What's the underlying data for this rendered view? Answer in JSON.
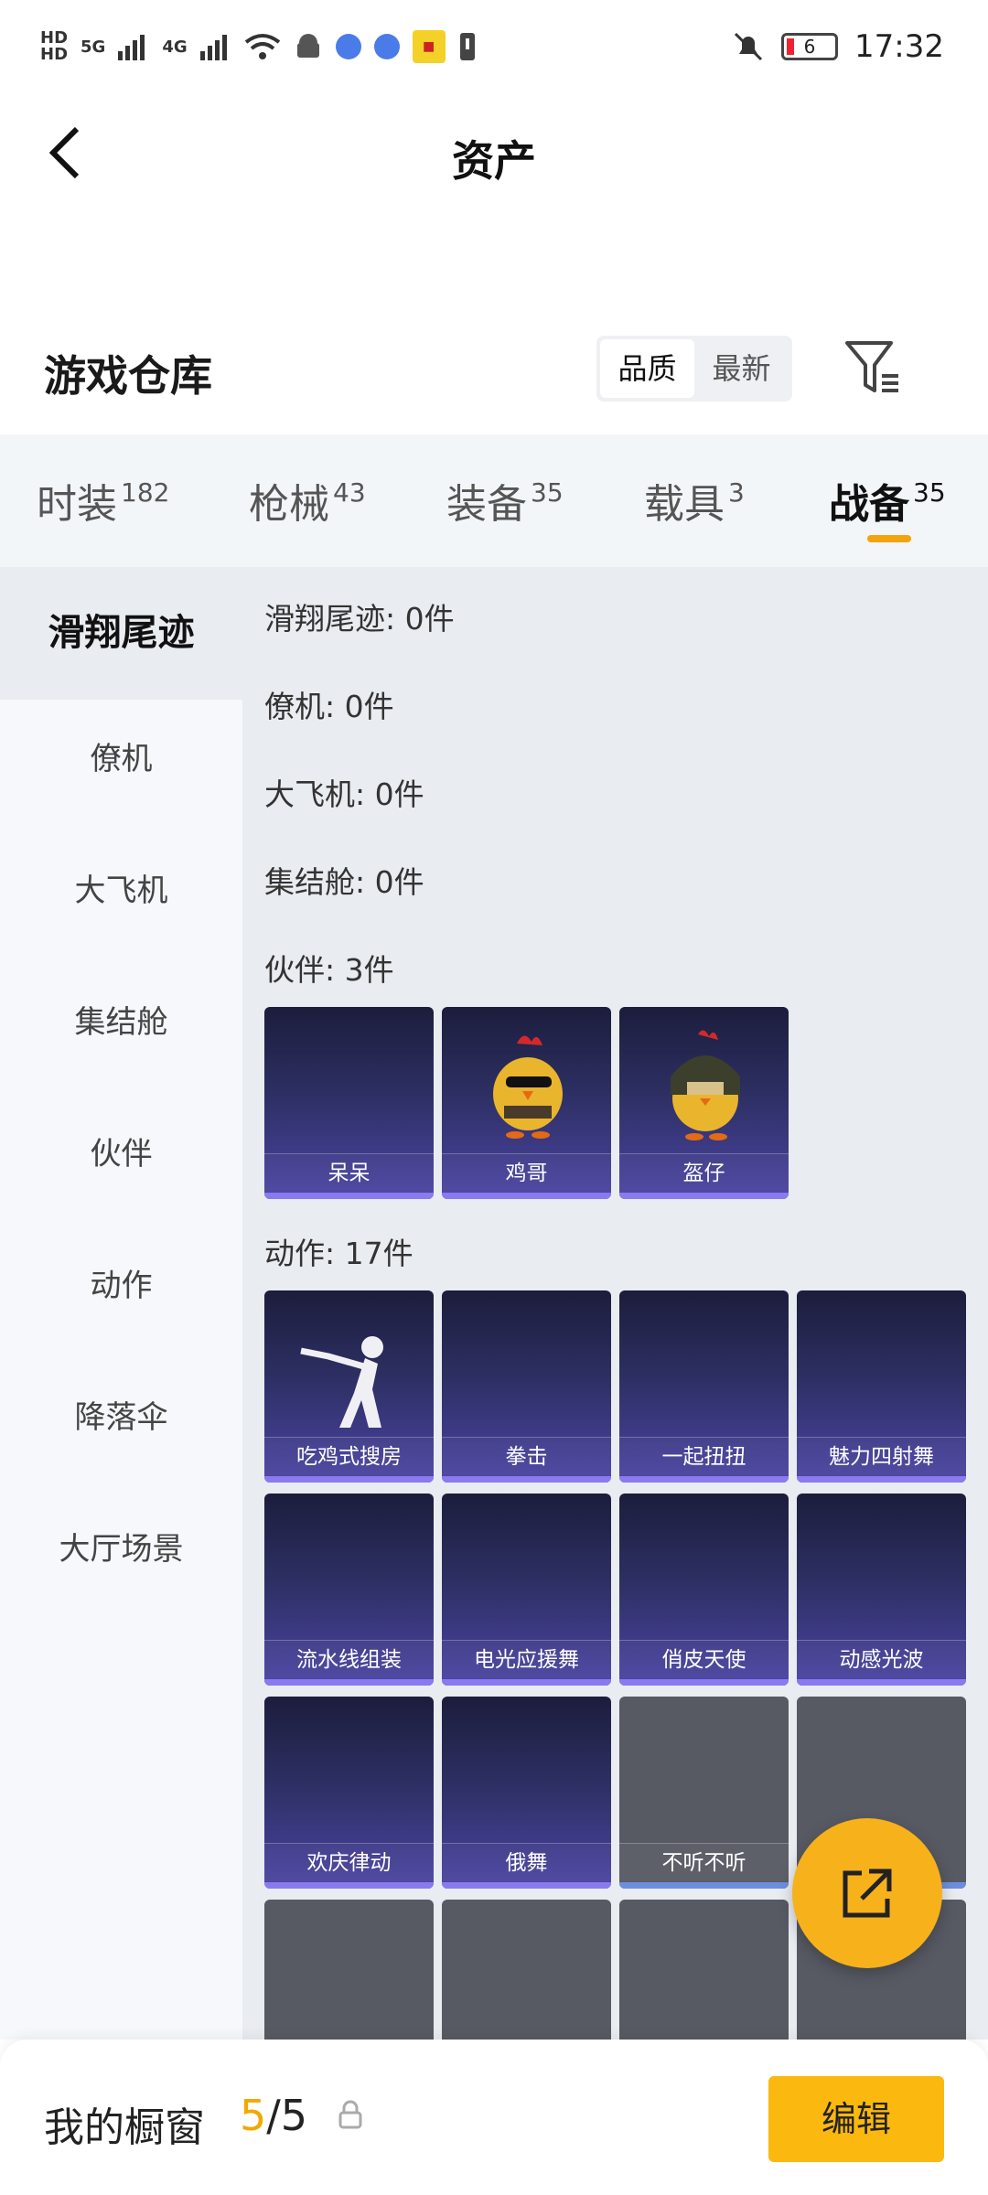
{
  "status_bar": {
    "network_label_1": "HD",
    "network_label_2": "HD",
    "net_5g": "5G",
    "net_4g": "4G",
    "battery_level": "6",
    "time": "17:32"
  },
  "header": {
    "title": "资产"
  },
  "warehouse": {
    "title": "游戏仓库",
    "sort_options": [
      "品质",
      "最新"
    ],
    "sort_selected": "品质"
  },
  "tabs": [
    {
      "label": "时装",
      "count": "182"
    },
    {
      "label": "枪械",
      "count": "43"
    },
    {
      "label": "装备",
      "count": "35"
    },
    {
      "label": "载具",
      "count": "3"
    },
    {
      "label": "战备",
      "count": "35"
    }
  ],
  "active_tab": "战备",
  "sidebar": {
    "items": [
      "滑翔尾迹",
      "僚机",
      "大飞机",
      "集结舱",
      "伙伴",
      "动作",
      "降落伞",
      "大厅场景"
    ],
    "active": "滑翔尾迹"
  },
  "sections": {
    "glide_trail": "滑翔尾迹: 0件",
    "wingman": "僚机: 0件",
    "big_plane": "大飞机: 0件",
    "gathering_pod": "集结舱: 0件",
    "partner": "伙伴: 3件",
    "action": "动作: 17件"
  },
  "partner_items": [
    "呆呆",
    "鸡哥",
    "盔仔"
  ],
  "action_items": [
    "吃鸡式搜房",
    "拳击",
    "一起扭扭",
    "魅力四射舞",
    "流水线组装",
    "电光应援舞",
    "俏皮天使",
    "动感光波",
    "欢庆律动",
    "俄舞",
    "不听不听"
  ],
  "bottom_bar": {
    "label": "我的橱窗",
    "count_current": "5",
    "count_total": "/5",
    "edit_label": "编辑"
  },
  "colors": {
    "accent": "#f5a30b",
    "card_purple": "#4b44a3",
    "card_grey": "#575a63",
    "edit_button": "#fbb80e"
  }
}
